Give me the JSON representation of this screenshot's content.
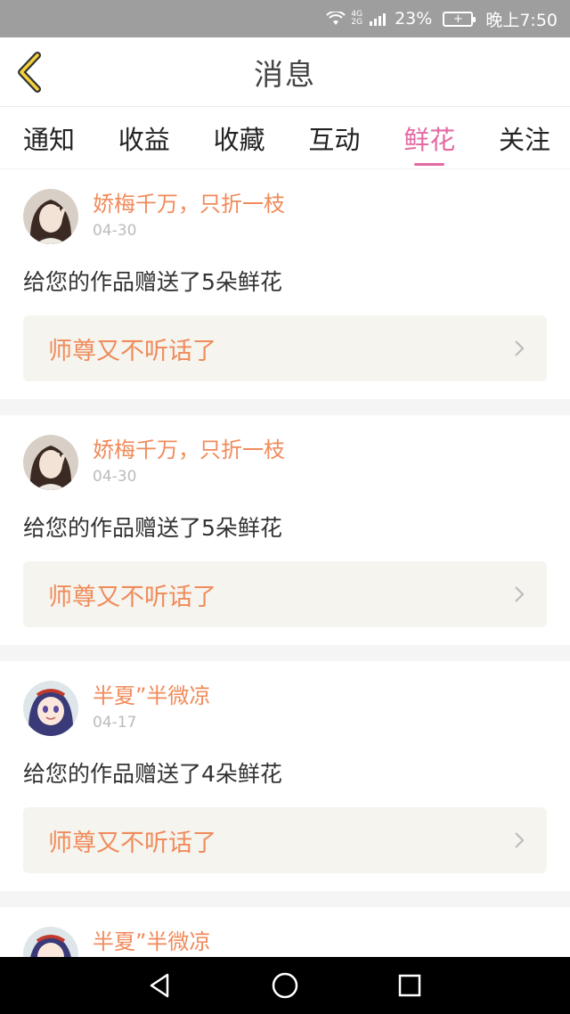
{
  "status_bar": {
    "network": "4G",
    "network2": "2G",
    "battery_percent": "23%",
    "time": "晚上7:50"
  },
  "header": {
    "title": "消息"
  },
  "tabs": [
    {
      "label": "通知",
      "active": false
    },
    {
      "label": "收益",
      "active": false
    },
    {
      "label": "收藏",
      "active": false
    },
    {
      "label": "互动",
      "active": false
    },
    {
      "label": "鲜花",
      "active": true
    },
    {
      "label": "关注",
      "active": false
    }
  ],
  "messages": [
    {
      "user": "娇梅千万，只折一枝",
      "date": "04-30",
      "text": "给您的作品赠送了5朵鲜花",
      "work": "师尊又不听话了",
      "avatar_icon": "user-avatar-photo"
    },
    {
      "user": "娇梅千万，只折一枝",
      "date": "04-30",
      "text": "给您的作品赠送了5朵鲜花",
      "work": "师尊又不听话了",
      "avatar_icon": "user-avatar-photo"
    },
    {
      "user": "半夏”半微凉",
      "date": "04-17",
      "text": "给您的作品赠送了4朵鲜花",
      "work": "师尊又不听话了",
      "avatar_icon": "user-avatar-anime"
    },
    {
      "user": "半夏”半微凉",
      "avatar_icon": "user-avatar-anime"
    }
  ],
  "colors": {
    "accent_pink": "#e46aa3",
    "accent_orange": "#f08b5b",
    "status_bar": "#9e9e9e",
    "nav_bar": "#000000"
  }
}
